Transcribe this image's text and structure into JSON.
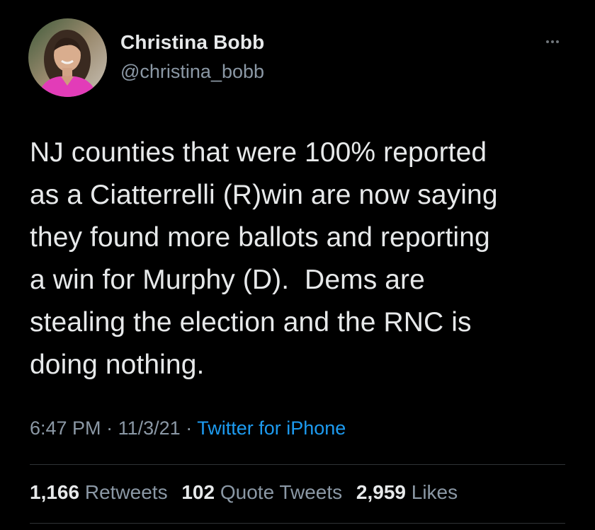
{
  "author": {
    "name": "Christina Bobb",
    "handle": "@christina_bobb"
  },
  "tweet": {
    "text": "NJ counties that were 100% reported\nas a Ciatterrelli (R)win are now saying\nthey found more ballots and reporting\na win for Murphy (D).  Dems are\nstealing the election and the RNC is\ndoing nothing.",
    "time": "6:47 PM",
    "date": "11/3/21",
    "separator": "·",
    "source": "Twitter for iPhone"
  },
  "stats": {
    "retweets_count": "1,166",
    "retweets_label": "Retweets",
    "quotes_count": "102",
    "quotes_label": "Quote Tweets",
    "likes_count": "2,959",
    "likes_label": "Likes"
  },
  "icons": {
    "more": "more-horizontal-icon"
  },
  "colors": {
    "background": "#000000",
    "primary_text": "#e7e9ea",
    "secondary_text": "#8b98a5",
    "link": "#1d9bf0",
    "divider": "#2f3336"
  }
}
